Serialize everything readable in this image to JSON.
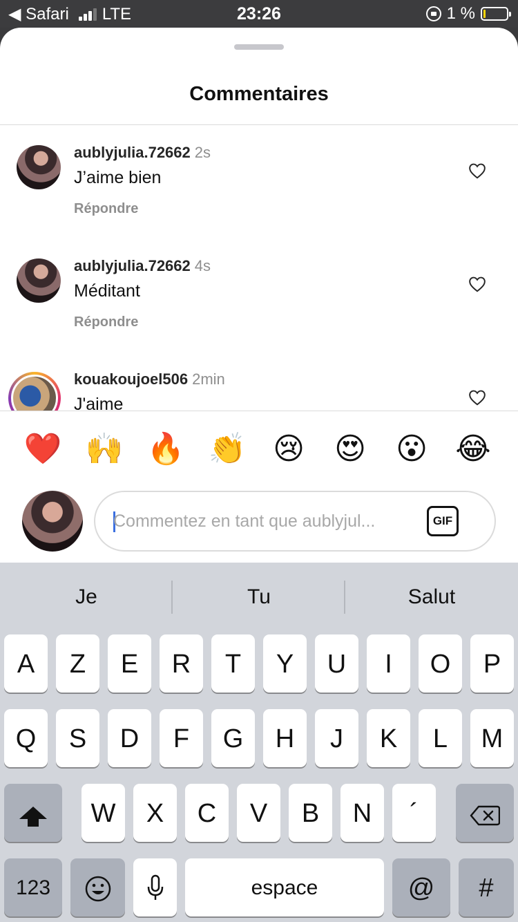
{
  "status_bar": {
    "back_app": "◀ Safari",
    "carrier": "LTE",
    "time": "23:26",
    "battery": "1 %",
    "battery_color": "#ffd60a"
  },
  "sheet": {
    "title": "Commentaires"
  },
  "comments": [
    {
      "username": "aublyjulia.72662",
      "time": "2s",
      "text": "J’aime bien",
      "reply_label": "Répondre"
    },
    {
      "username": "aublyjulia.72662",
      "time": "4s",
      "text": "Méditant",
      "reply_label": "Répondre"
    },
    {
      "username": "kouakoujoel506",
      "time": "2min",
      "text": "J'aime",
      "reply_label": ""
    }
  ],
  "reactions": [
    "❤️",
    "🙌",
    "🔥",
    "👏",
    "😢",
    "😍",
    "😮",
    "😂"
  ],
  "composer": {
    "placeholder": "Commentez en tant que aublyjul...",
    "gif_label": "GIF"
  },
  "keyboard": {
    "suggestions": [
      "Je",
      "Tu",
      "Salut"
    ],
    "row1": [
      "A",
      "Z",
      "E",
      "R",
      "T",
      "Y",
      "U",
      "I",
      "O",
      "P"
    ],
    "row2": [
      "Q",
      "S",
      "D",
      "F",
      "G",
      "H",
      "J",
      "K",
      "L",
      "M"
    ],
    "row3": [
      "W",
      "X",
      "C",
      "V",
      "B",
      "N",
      "´"
    ],
    "numbers_label": "123",
    "space_label": "espace",
    "at_label": "@",
    "hash_label": "#"
  }
}
